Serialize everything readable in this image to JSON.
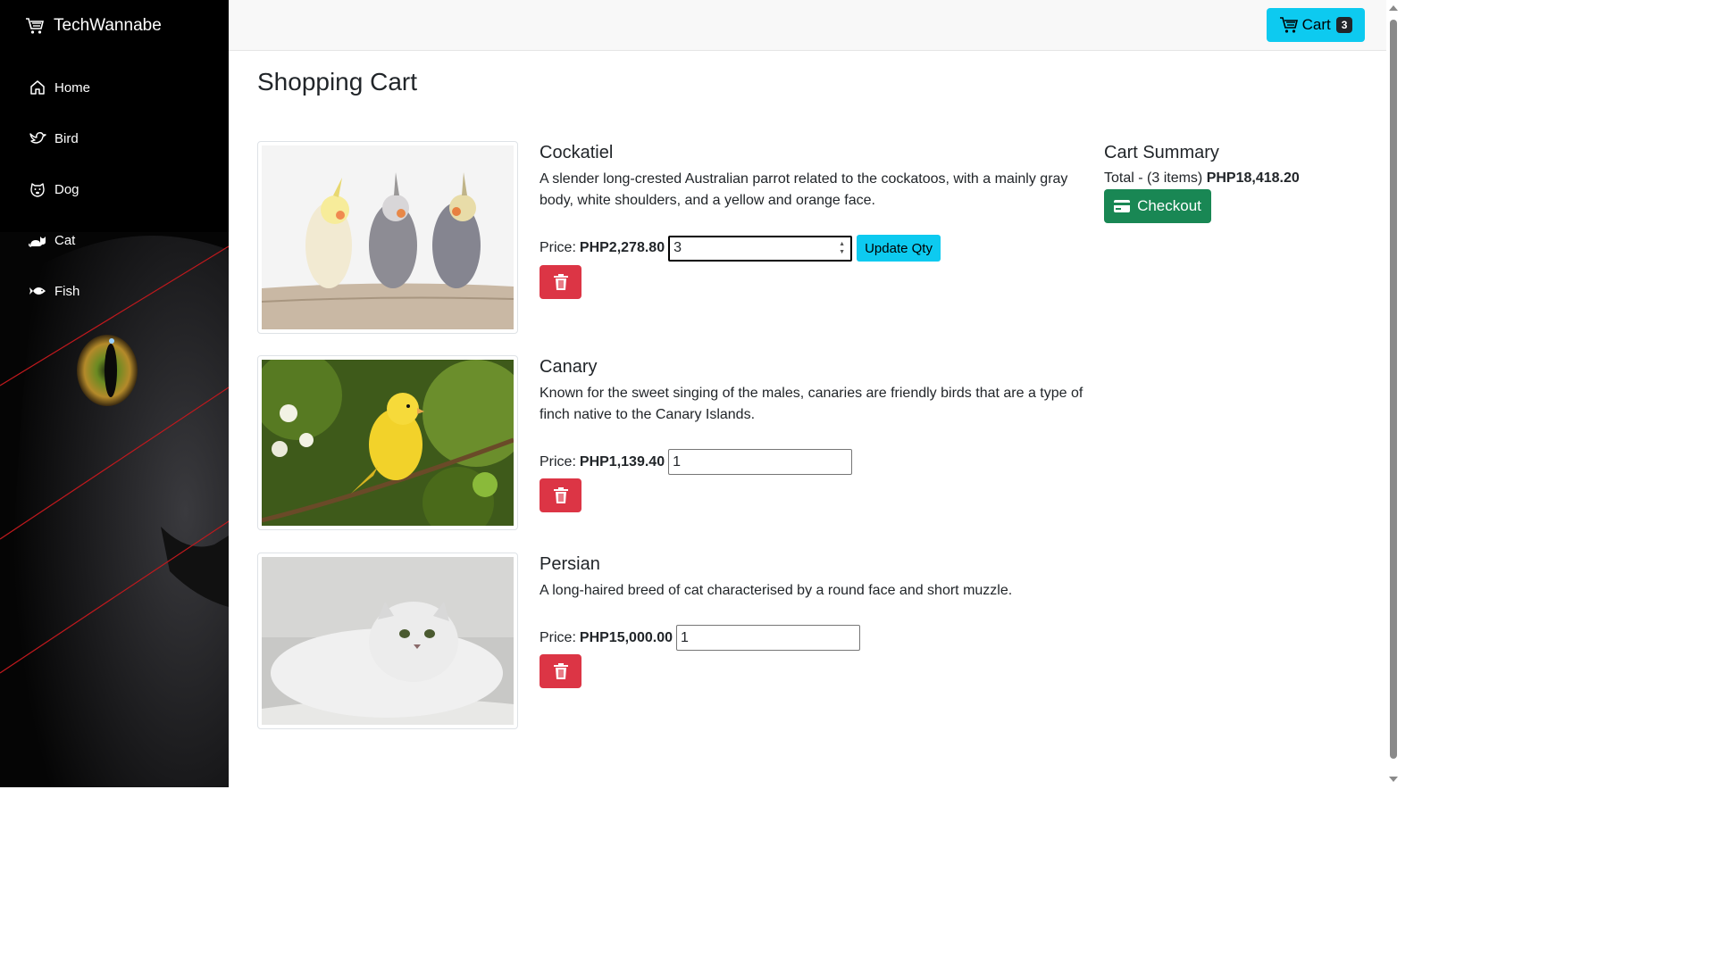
{
  "brand": {
    "name": "TechWannabe",
    "icon": "cart-icon"
  },
  "sidebar": {
    "items": [
      {
        "label": "Home",
        "icon": "home-icon"
      },
      {
        "label": "Bird",
        "icon": "bird-icon"
      },
      {
        "label": "Dog",
        "icon": "dog-icon"
      },
      {
        "label": "Cat",
        "icon": "cat-icon"
      },
      {
        "label": "Fish",
        "icon": "fish-icon"
      }
    ]
  },
  "header": {
    "cart_label": "Cart",
    "cart_count": "3"
  },
  "page": {
    "title": "Shopping Cart"
  },
  "cart": {
    "items": [
      {
        "name": "Cockatiel",
        "description": "A slender long-crested Australian parrot related to the cockatoos, with a mainly gray body, white shoulders, and a yellow and orange face.",
        "price_label": "Price:",
        "price": "PHP2,278.80",
        "qty": "3",
        "update_label": "Update Qty"
      },
      {
        "name": "Canary",
        "description": "Known for the sweet singing of the males, canaries are friendly birds that are a type of finch native to the Canary Islands.",
        "price_label": "Price:",
        "price": "PHP1,139.40",
        "qty": "1"
      },
      {
        "name": "Persian",
        "description": "A long-haired breed of cat characterised by a round face and short muzzle.",
        "price_label": "Price:",
        "price": "PHP15,000.00",
        "qty": "1"
      }
    ]
  },
  "summary": {
    "title": "Cart Summary",
    "total_label": "Total - (3 items)",
    "total_value": "PHP18,418.20",
    "checkout_label": "Checkout"
  },
  "colors": {
    "sidebar_bg": "#000000",
    "accent_info": "#0dcaf0",
    "danger": "#dc3545",
    "success": "#198754"
  }
}
